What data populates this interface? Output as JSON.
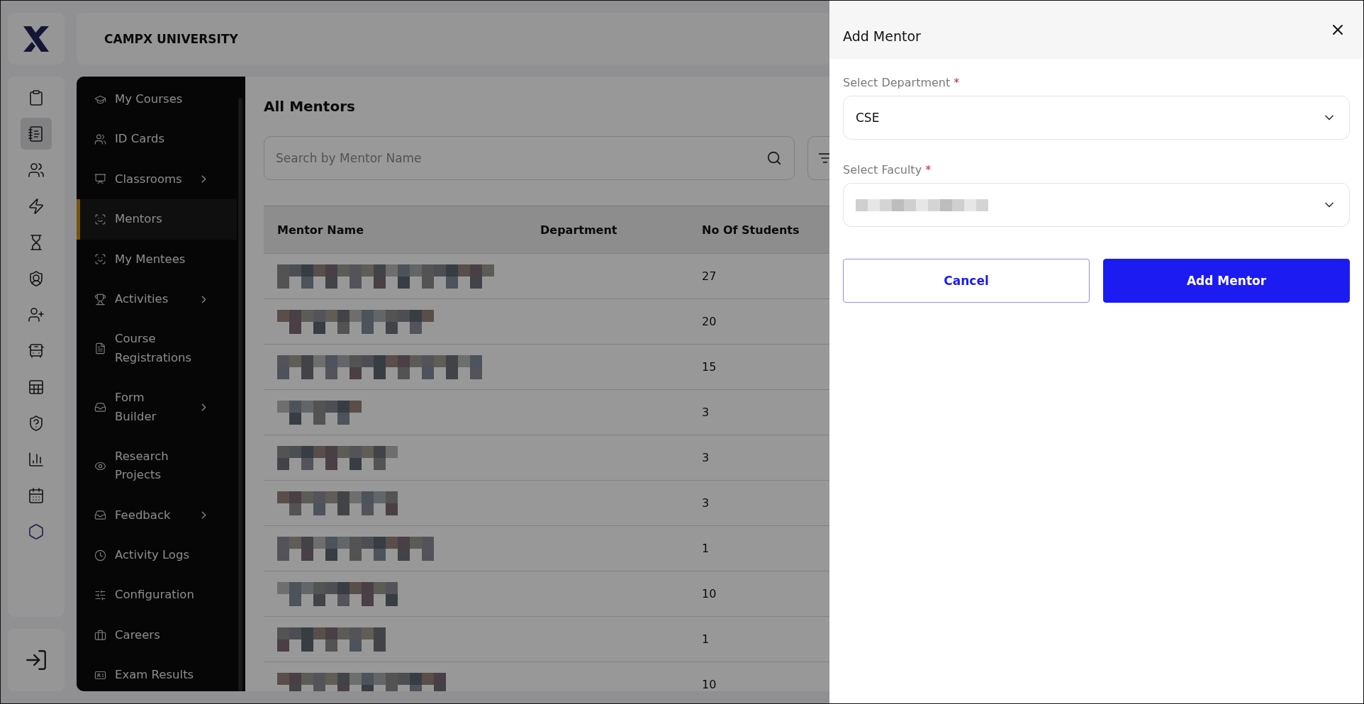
{
  "brand": {
    "title": "CAMPX UNIVERSITY"
  },
  "rail": [
    {
      "selected": false
    },
    {
      "selected": true
    },
    {
      "selected": false
    },
    {
      "selected": false
    },
    {
      "selected": false
    },
    {
      "selected": false
    },
    {
      "selected": false
    },
    {
      "selected": false
    },
    {
      "selected": false
    },
    {
      "selected": false
    },
    {
      "selected": false
    },
    {
      "selected": false
    },
    {
      "selected": false
    }
  ],
  "sidebar": {
    "items": [
      {
        "label": "My Courses",
        "selected": false,
        "expandable": false
      },
      {
        "label": "ID Cards",
        "selected": false,
        "expandable": false
      },
      {
        "label": "Classrooms",
        "selected": false,
        "expandable": true
      },
      {
        "label": "Mentors",
        "selected": true,
        "expandable": false
      },
      {
        "label": "My Mentees",
        "selected": false,
        "expandable": false
      },
      {
        "label": "Activities",
        "selected": false,
        "expandable": true
      },
      {
        "label": "Course Registrations",
        "selected": false,
        "expandable": false
      },
      {
        "label": "Form Builder",
        "selected": false,
        "expandable": true
      },
      {
        "label": "Research Projects",
        "selected": false,
        "expandable": false
      },
      {
        "label": "Feedback",
        "selected": false,
        "expandable": true
      },
      {
        "label": "Activity Logs",
        "selected": false,
        "expandable": false
      },
      {
        "label": "Configuration",
        "selected": false,
        "expandable": false
      },
      {
        "label": "Careers",
        "selected": false,
        "expandable": false
      },
      {
        "label": "Exam Results",
        "selected": false,
        "expandable": false
      }
    ]
  },
  "main": {
    "title": "All Mentors",
    "search": {
      "placeholder": "Search by Mentor Name"
    },
    "table": {
      "columns": [
        "Mentor Name",
        "Department",
        "No Of Students"
      ],
      "rows": [
        {
          "name_redacted": true,
          "no_of_students": "27"
        },
        {
          "name_redacted": true,
          "no_of_students": "20"
        },
        {
          "name_redacted": true,
          "no_of_students": "15"
        },
        {
          "name_redacted": true,
          "no_of_students": "3"
        },
        {
          "name_redacted": true,
          "no_of_students": "3"
        },
        {
          "name_redacted": true,
          "no_of_students": "3"
        },
        {
          "name_redacted": true,
          "no_of_students": "1"
        },
        {
          "name_redacted": true,
          "no_of_students": "10"
        },
        {
          "name_redacted": true,
          "no_of_students": "1"
        },
        {
          "name_redacted": true,
          "no_of_students": "10"
        }
      ]
    }
  },
  "drawer": {
    "title": "Add Mentor",
    "fields": [
      {
        "label": "Select Department",
        "required_mark": "*",
        "value": "CSE",
        "redacted": false
      },
      {
        "label": "Select Faculty",
        "required_mark": "*",
        "redacted": true
      }
    ],
    "buttons": [
      {
        "label": "Cancel",
        "kind": "secondary"
      },
      {
        "label": "Add Mentor",
        "kind": "primary"
      }
    ]
  }
}
